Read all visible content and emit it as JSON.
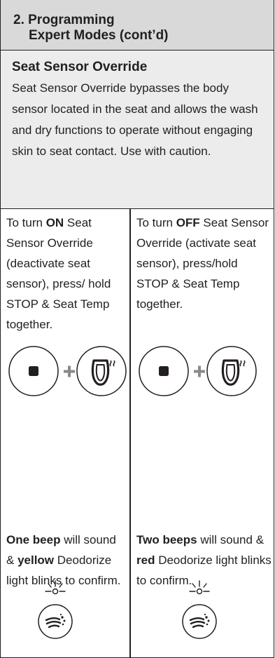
{
  "header": {
    "line1": "2. Programming",
    "line2": "Expert Modes (cont’d)"
  },
  "intro": {
    "title": "Seat Sensor Override",
    "body": "Seat Sensor Override bypasses the body sensor located in the seat and allows the wash and dry functions to operate without engaging skin to seat contact. Use with caution."
  },
  "left": {
    "instr_pre": "To turn ",
    "instr_bold": "ON",
    "instr_post": " Seat Sensor Override (deactivate seat sensor), press/ hold STOP & Seat Temp together.",
    "conf_b1": "One beep",
    "conf_t1": " will sound & ",
    "conf_b2": "yellow",
    "conf_t2": " Deodorize light blinks to confirm."
  },
  "right": {
    "instr_pre": "To turn ",
    "instr_bold": "OFF",
    "instr_post": " Seat Sensor Override (activate seat sensor), press/hold STOP & Seat Temp together.",
    "conf_b1": "Two beeps",
    "conf_t1": " will sound & ",
    "conf_b2": "red",
    "conf_t2": " Deodorize light blinks to confirm."
  },
  "icons": {
    "button_a": "stop-button-icon",
    "plus": "plus-icon",
    "button_b": "seat-temp-button-icon",
    "lamp": "blinking-light-icon",
    "deodorize": "deodorize-button-icon"
  },
  "colors": {
    "text": "#231f20",
    "header_bg": "#d9d9da",
    "intro_bg": "#ececec",
    "plus": "#8a8a8d"
  }
}
